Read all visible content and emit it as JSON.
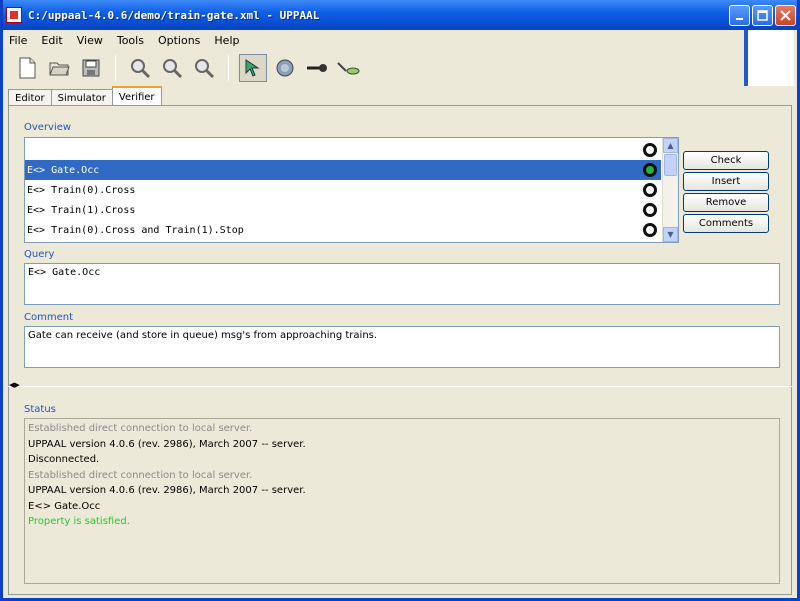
{
  "window": {
    "title": "C:/uppaal-4.0.6/demo/train-gate.xml - UPPAAL",
    "controls": [
      "minimize-icon",
      "maximize-icon",
      "close-icon"
    ]
  },
  "menu": [
    "File",
    "Edit",
    "View",
    "Tools",
    "Options",
    "Help"
  ],
  "toolbar": {
    "icons": [
      "new-file-icon",
      "open-icon",
      "save-icon",
      "zoom-in-icon",
      "zoom-out-icon",
      "zoom-fit-icon",
      "select-tool-icon",
      "globe-icon",
      "nail-icon",
      "edge-tool-icon"
    ]
  },
  "tabs": [
    {
      "label": "Editor",
      "active": false
    },
    {
      "label": "Simulator",
      "active": false
    },
    {
      "label": "Verifier",
      "active": true
    }
  ],
  "overview": {
    "label": "Overview",
    "rows": [
      {
        "text": "",
        "status": "unknown"
      },
      {
        "text": "E<> Gate.Occ",
        "status": "satisfied",
        "selected": true
      },
      {
        "text": "E<> Train(0).Cross",
        "status": "unknown"
      },
      {
        "text": "E<> Train(1).Cross",
        "status": "unknown"
      },
      {
        "text": "E<> Train(0).Cross and Train(1).Stop",
        "status": "unknown"
      }
    ]
  },
  "buttons": {
    "check": "Check",
    "insert": "Insert",
    "remove": "Remove",
    "comments": "Comments"
  },
  "query": {
    "label": "Query",
    "value": "E<> Gate.Occ"
  },
  "comment": {
    "label": "Comment",
    "value": "Gate can receive (and store in queue) msg's from approaching trains."
  },
  "status": {
    "label": "Status",
    "lines": [
      {
        "text": "Established direct connection to local server.",
        "style": "grey"
      },
      {
        "text": "UPPAAL version 4.0.6 (rev. 2986), March 2007 -- server.",
        "style": "normal"
      },
      {
        "text": "Disconnected.",
        "style": "normal"
      },
      {
        "text": "Established direct connection to local server.",
        "style": "grey"
      },
      {
        "text": "UPPAAL version 4.0.6 (rev. 2986), March 2007 -- server.",
        "style": "normal"
      },
      {
        "text": "E<> Gate.Occ",
        "style": "normal"
      },
      {
        "text": "Property is satisfied.",
        "style": "green"
      }
    ]
  },
  "colors": {
    "titlebar": "#0A51D8",
    "selection": "#316AC5",
    "section_label": "#2255BB",
    "satisfied": "#2FB02F",
    "satisfied_text": "#22CC22"
  }
}
